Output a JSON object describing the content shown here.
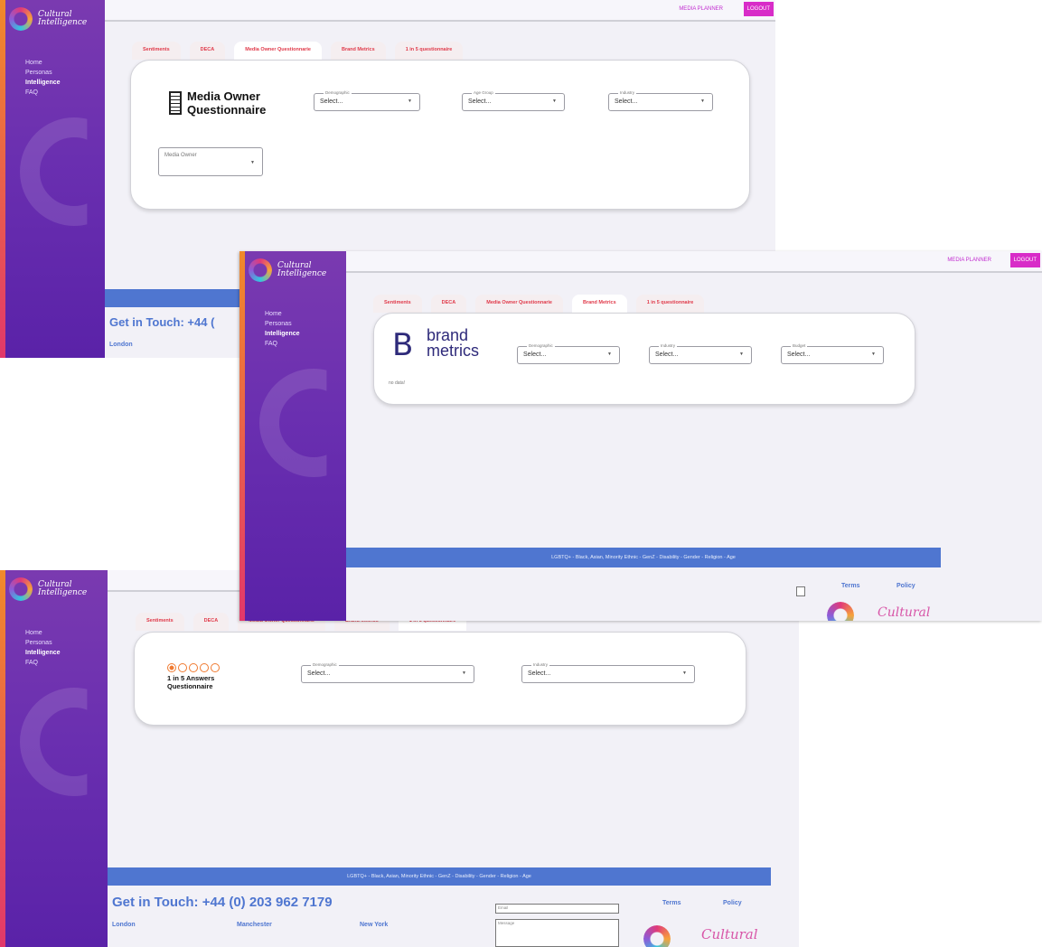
{
  "brand": {
    "logo_line1": "Cultural",
    "logo_line2": "Intelligence"
  },
  "nav": {
    "items": [
      "Home",
      "Personas",
      "Intelligence",
      "FAQ"
    ]
  },
  "header": {
    "media_planner": "MEDIA PLANNER",
    "logout": "LOGOUT"
  },
  "tabs": [
    "Sentiments",
    "DECA",
    "Media Owner Questionnarie",
    "Brand Metrics",
    "1 in 5 questionnaire"
  ],
  "screen1": {
    "title_line1": "Media Owner",
    "title_line2": "Questionnaire",
    "selects": [
      {
        "label": "Demographic",
        "value": "Select..."
      },
      {
        "label": "Age Group",
        "value": "Select..."
      },
      {
        "label": "Industry",
        "value": "Select..."
      }
    ],
    "media_owner_select": "Media Owner",
    "get_in_touch": "Get in Touch: +44 (",
    "city1": "London"
  },
  "screen2": {
    "brand_line1": "brand",
    "brand_line2": "metrics",
    "selects": [
      {
        "label": "Demographic",
        "value": "Select..."
      },
      {
        "label": "Industry",
        "value": "Select..."
      },
      {
        "label": "Budget",
        "value": "Select..."
      }
    ],
    "no_data": "no data!",
    "band_text": "LGBTQ+ - Black, Asian, Minority Ethnic - GenZ - Disability - Gender - Religion - Age",
    "terms": "Terms",
    "policy": "Policy",
    "footer_logo": "Cultural"
  },
  "screen3": {
    "title_line1": "1 in 5 Answers",
    "title_line2": "Questionnaire",
    "selects": [
      {
        "label": "Demographic",
        "value": "Select..."
      },
      {
        "label": "Industry",
        "value": "Select..."
      }
    ],
    "band_text": "LGBTQ+ - Black, Asian, Minority Ethnic - GenZ - Disability - Gender - Religion - Age",
    "get_in_touch": "Get in Touch: +44 (0) 203 962 7179",
    "cities": [
      "London",
      "Manchester",
      "New York"
    ],
    "email_placeholder": "Email",
    "message_placeholder": "Message",
    "terms": "Terms",
    "policy": "Policy",
    "footer_logo": "Cultural"
  },
  "colors": {
    "accent_pink": "#d82cc8",
    "tab_red": "#e03a4a",
    "band_blue": "#4f76d0",
    "sidebar_purple": "#6a2fb0"
  }
}
